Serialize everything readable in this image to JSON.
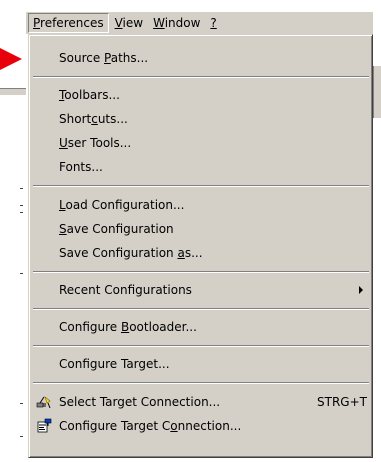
{
  "menubar": {
    "items": [
      {
        "pre": "",
        "key": "P",
        "post": "references"
      },
      {
        "pre": "",
        "key": "V",
        "post": "iew"
      },
      {
        "pre": "",
        "key": "W",
        "post": "indow"
      },
      {
        "pre": "",
        "key": "?",
        "post": ""
      }
    ]
  },
  "menu": {
    "source_paths": {
      "pre": "Source ",
      "key": "P",
      "post": "aths..."
    },
    "toolbars": {
      "pre": "",
      "key": "T",
      "post": "oolbars..."
    },
    "shortcuts": {
      "pre": "Short",
      "key": "c",
      "post": "uts..."
    },
    "user_tools": {
      "pre": "",
      "key": "U",
      "post": "ser Tools..."
    },
    "fonts": {
      "pre": "",
      "key": "",
      "post": "Fonts..."
    },
    "load_config": {
      "pre": "",
      "key": "L",
      "post": "oad Configuration..."
    },
    "save_config": {
      "pre": "",
      "key": "S",
      "post": "ave Configuration"
    },
    "save_config_as": {
      "pre": "Save Configuration ",
      "key": "a",
      "post": "s..."
    },
    "recent_configs": {
      "pre": "",
      "key": "",
      "post": "Recent Configurations"
    },
    "configure_bootloader": {
      "pre": "Configure ",
      "key": "B",
      "post": "ootloader..."
    },
    "configure_target": {
      "pre": "",
      "key": "",
      "post": "Configure Target..."
    },
    "select_target_connection": {
      "pre": "",
      "key": "",
      "post": "Select Target Connection...",
      "accel": "STRG+T"
    },
    "configure_target_connection": {
      "pre": "Configure Target C",
      "key": "o",
      "post": "nnection..."
    }
  },
  "icons": {
    "select_target_connection": "plug-connect-icon",
    "configure_target_connection": "connection-settings-icon"
  },
  "colors": {
    "menu_face": "#d4d0c8",
    "pointer_arrow": "#e8000a"
  }
}
